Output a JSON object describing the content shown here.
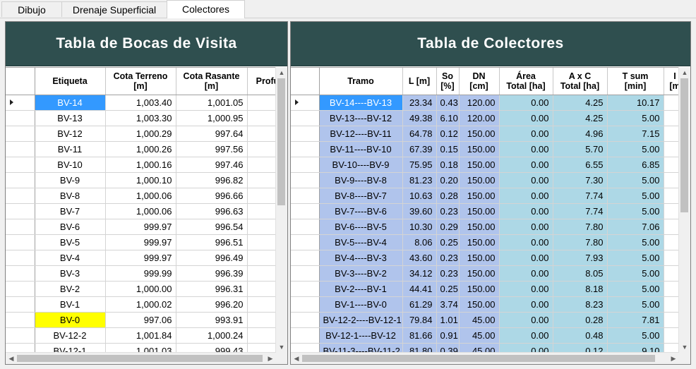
{
  "tabs": [
    "Dibujo",
    "Drenaje Superficial",
    "Colectores"
  ],
  "bocas": {
    "title": "Tabla de Bocas de Visita",
    "headers": [
      "Etiqueta",
      "Cota Terreno\n[m]",
      "Cota Rasante\n[m]",
      "Profu"
    ],
    "rows": [
      [
        "BV-14",
        "1,003.40",
        "1,001.05"
      ],
      [
        "BV-13",
        "1,003.30",
        "1,000.95"
      ],
      [
        "BV-12",
        "1,000.29",
        "997.64"
      ],
      [
        "BV-11",
        "1,000.26",
        "997.56"
      ],
      [
        "BV-10",
        "1,000.16",
        "997.46"
      ],
      [
        "BV-9",
        "1,000.10",
        "996.82"
      ],
      [
        "BV-8",
        "1,000.06",
        "996.66"
      ],
      [
        "BV-7",
        "1,000.06",
        "996.63"
      ],
      [
        "BV-6",
        "999.97",
        "996.54"
      ],
      [
        "BV-5",
        "999.97",
        "996.51"
      ],
      [
        "BV-4",
        "999.97",
        "996.49"
      ],
      [
        "BV-3",
        "999.99",
        "996.39"
      ],
      [
        "BV-2",
        "1,000.00",
        "996.31"
      ],
      [
        "BV-1",
        "1,000.02",
        "996.20"
      ],
      [
        "BV-0",
        "997.06",
        "993.91"
      ],
      [
        "BV-12-2",
        "1,001.84",
        "1,000.24"
      ],
      [
        "BV-12-1",
        "1,001.03",
        "999.43"
      ]
    ]
  },
  "colectores": {
    "title": "Tabla de Colectores",
    "headers": [
      "Tramo",
      "L [m]",
      "So\n[%]",
      "DN\n[cm]",
      "Área\nTotal [ha]",
      "A x C\nTotal [ha]",
      "T sum\n[min]",
      "I\n[m"
    ],
    "rows": [
      [
        "BV-14----BV-13",
        "23.34",
        "0.43",
        "120.00",
        "0.00",
        "4.25",
        "10.17"
      ],
      [
        "BV-13----BV-12",
        "49.38",
        "6.10",
        "120.00",
        "0.00",
        "4.25",
        "5.00"
      ],
      [
        "BV-12----BV-11",
        "64.78",
        "0.12",
        "150.00",
        "0.00",
        "4.96",
        "7.15"
      ],
      [
        "BV-11----BV-10",
        "67.39",
        "0.15",
        "150.00",
        "0.00",
        "5.70",
        "5.00"
      ],
      [
        "BV-10----BV-9",
        "75.95",
        "0.18",
        "150.00",
        "0.00",
        "6.55",
        "6.85"
      ],
      [
        "BV-9----BV-8",
        "81.23",
        "0.20",
        "150.00",
        "0.00",
        "7.30",
        "5.00"
      ],
      [
        "BV-8----BV-7",
        "10.63",
        "0.28",
        "150.00",
        "0.00",
        "7.74",
        "5.00"
      ],
      [
        "BV-7----BV-6",
        "39.60",
        "0.23",
        "150.00",
        "0.00",
        "7.74",
        "5.00"
      ],
      [
        "BV-6----BV-5",
        "10.30",
        "0.29",
        "150.00",
        "0.00",
        "7.80",
        "7.06"
      ],
      [
        "BV-5----BV-4",
        "8.06",
        "0.25",
        "150.00",
        "0.00",
        "7.80",
        "5.00"
      ],
      [
        "BV-4----BV-3",
        "43.60",
        "0.23",
        "150.00",
        "0.00",
        "7.93",
        "5.00"
      ],
      [
        "BV-3----BV-2",
        "34.12",
        "0.23",
        "150.00",
        "0.00",
        "8.05",
        "5.00"
      ],
      [
        "BV-2----BV-1",
        "44.41",
        "0.25",
        "150.00",
        "0.00",
        "8.18",
        "5.00"
      ],
      [
        "BV-1----BV-0",
        "61.29",
        "3.74",
        "150.00",
        "0.00",
        "8.23",
        "5.00"
      ],
      [
        "BV-12-2----BV-12-1",
        "79.84",
        "1.01",
        "45.00",
        "0.00",
        "0.28",
        "7.81"
      ],
      [
        "BV-12-1----BV-12",
        "81.66",
        "0.91",
        "45.00",
        "0.00",
        "0.48",
        "5.00"
      ],
      [
        "BV-11-3----BV-11-2",
        "81.80",
        "0.39",
        "45.00",
        "0.00",
        "0.12",
        "9.10"
      ]
    ]
  },
  "colors": {
    "title_bg": "#2f4f4f",
    "selected": "#3399ff",
    "highlight": "#ffff00",
    "col_blue": "#b0c4ec",
    "col_cyan": "#add8e6"
  },
  "icons": [
    "row-indicator-arrow-icon",
    "scroll-up-arrow-icon",
    "scroll-down-arrow-icon",
    "scroll-left-arrow-icon",
    "scroll-right-arrow-icon"
  ]
}
